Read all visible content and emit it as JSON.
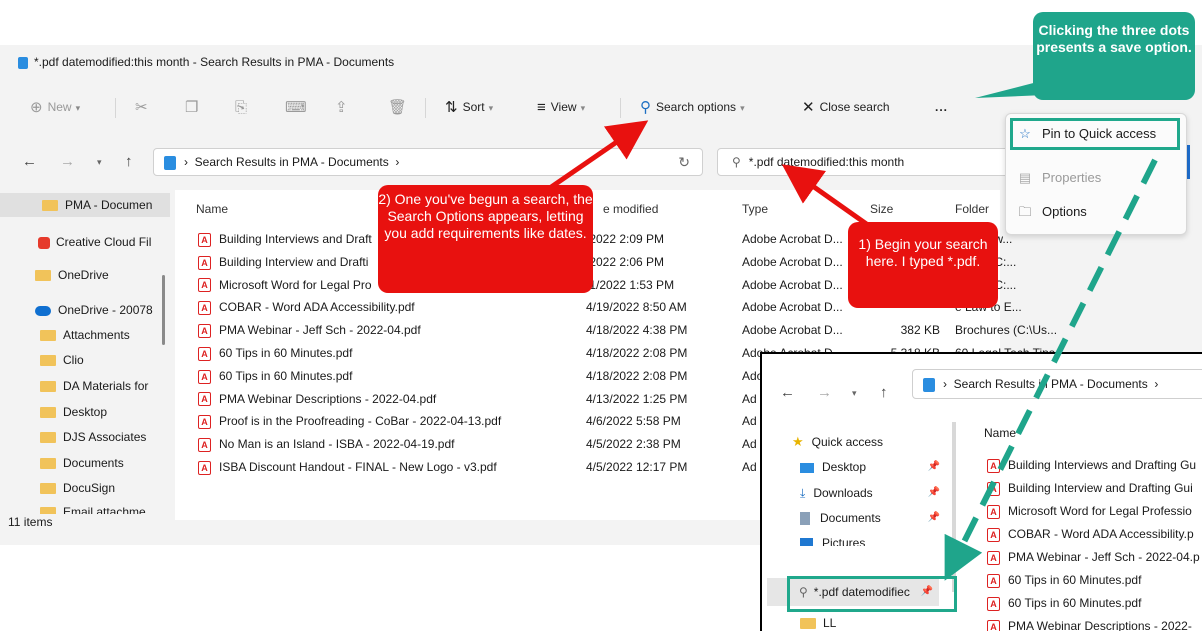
{
  "window": {
    "title": "*.pdf datemodified:this month - Search Results in PMA - Documents"
  },
  "toolbar": {
    "new_label": "New",
    "sort_label": "Sort",
    "view_label": "View",
    "search_options_label": "Search options",
    "close_search_label": "Close search",
    "more_label": "..."
  },
  "address": {
    "path": "Search Results in PMA - Documents",
    "search_value": "*.pdf datemodified:this month"
  },
  "sidebar": {
    "items": [
      {
        "label": "PMA - Documen"
      },
      {
        "label": "Creative Cloud Fil"
      },
      {
        "label": "OneDrive"
      },
      {
        "label": "OneDrive - 20078"
      },
      {
        "label": "Attachments"
      },
      {
        "label": "Clio"
      },
      {
        "label": "DA Materials for"
      },
      {
        "label": "Desktop"
      },
      {
        "label": "DJS Associates"
      },
      {
        "label": "Documents"
      },
      {
        "label": "DocuSign"
      },
      {
        "label": "Email attachme"
      }
    ]
  },
  "columns": {
    "name": "Name",
    "date": "e modified",
    "type": "Type",
    "size": "Size",
    "folder": "Folder"
  },
  "files": [
    {
      "name": "Building Interviews and Draft",
      "date": "/2022 2:09 PM",
      "type": "Adobe Acrobat D...",
      "size": "",
      "folder": "Interview..."
    },
    {
      "name": "Building Interview and Drafti",
      "date": "/2022 2:06 PM",
      "type": "Adobe Acrobat D...",
      "size": "",
      "folder": "terials (C:..."
    },
    {
      "name": "Microsoft Word for Legal Pro",
      "date": "/1/2022 1:53 PM",
      "type": "Adobe Acrobat D...",
      "size": "",
      "folder": "terials (C:..."
    },
    {
      "name": "COBAR - Word ADA Accessibility.pdf",
      "date": "4/19/2022 8:50 AM",
      "type": "Adobe Acrobat D...",
      "size": "",
      "folder": "e Law to E..."
    },
    {
      "name": "PMA Webinar - Jeff Sch - 2022-04.pdf",
      "date": "4/18/2022 4:38 PM",
      "type": "Adobe Acrobat D...",
      "size": "382 KB",
      "folder": "Brochures (C:\\Us..."
    },
    {
      "name": "60 Tips in 60 Minutes.pdf",
      "date": "4/18/2022 2:08 PM",
      "type": "Adobe Acrobat D...",
      "size": "5,318 KB",
      "folder": "60 Legal Tech Tips,..."
    },
    {
      "name": "60 Tips in 60 Minutes.pdf",
      "date": "4/18/2022 2:08 PM",
      "type": "Ado",
      "size": "",
      "folder": ""
    },
    {
      "name": "PMA Webinar Descriptions - 2022-04.pdf",
      "date": "4/13/2022 1:25 PM",
      "type": "Ad",
      "size": "",
      "folder": ""
    },
    {
      "name": "Proof is in the Proofreading - CoBar - 2022-04-13.pdf",
      "date": "4/6/2022 5:58 PM",
      "type": "Ad",
      "size": "",
      "folder": ""
    },
    {
      "name": "No Man is an Island - ISBA - 2022-04-19.pdf",
      "date": "4/5/2022 2:38 PM",
      "type": "Ad",
      "size": "",
      "folder": ""
    },
    {
      "name": "ISBA Discount Handout - FINAL - New Logo - v3.pdf",
      "date": "4/5/2022 12:17 PM",
      "type": "Ad",
      "size": "",
      "folder": ""
    }
  ],
  "status": {
    "count": "11 items"
  },
  "menu": {
    "pin_label": "Pin to Quick access",
    "properties_label": "Properties",
    "options_label": "Options"
  },
  "callouts": {
    "teal": "Clicking the three dots presents a save option.",
    "two": "2) One you've begun a search, the Search Options appears, letting you add requirements like dates.",
    "one": "1) Begin your search here. I typed *.pdf."
  },
  "inset": {
    "path": "Search Results in PMA - Documents",
    "name_header": "Name",
    "nav": [
      {
        "label": "Quick access"
      },
      {
        "label": "Desktop"
      },
      {
        "label": "Downloads"
      },
      {
        "label": "Documents"
      },
      {
        "label": "Pictures"
      },
      {
        "label": "*.pdf datemodifiec"
      },
      {
        "label": "LL"
      }
    ],
    "files": [
      {
        "name": "Building Interviews and Drafting Gu"
      },
      {
        "name": "Building Interview and Drafting Gui"
      },
      {
        "name": "Microsoft Word for Legal Professio"
      },
      {
        "name": "COBAR - Word ADA Accessibility.p"
      },
      {
        "name": "PMA Webinar - Jeff Sch - 2022-04.p"
      },
      {
        "name": "60 Tips in 60 Minutes.pdf"
      },
      {
        "name": "60 Tips in 60 Minutes.pdf"
      },
      {
        "name": "PMA Webinar Descriptions - 2022-"
      }
    ]
  },
  "colors": {
    "callout_red": "#e8110f",
    "teal": "#1fa58b",
    "accent_blue": "#1f6fd0"
  }
}
